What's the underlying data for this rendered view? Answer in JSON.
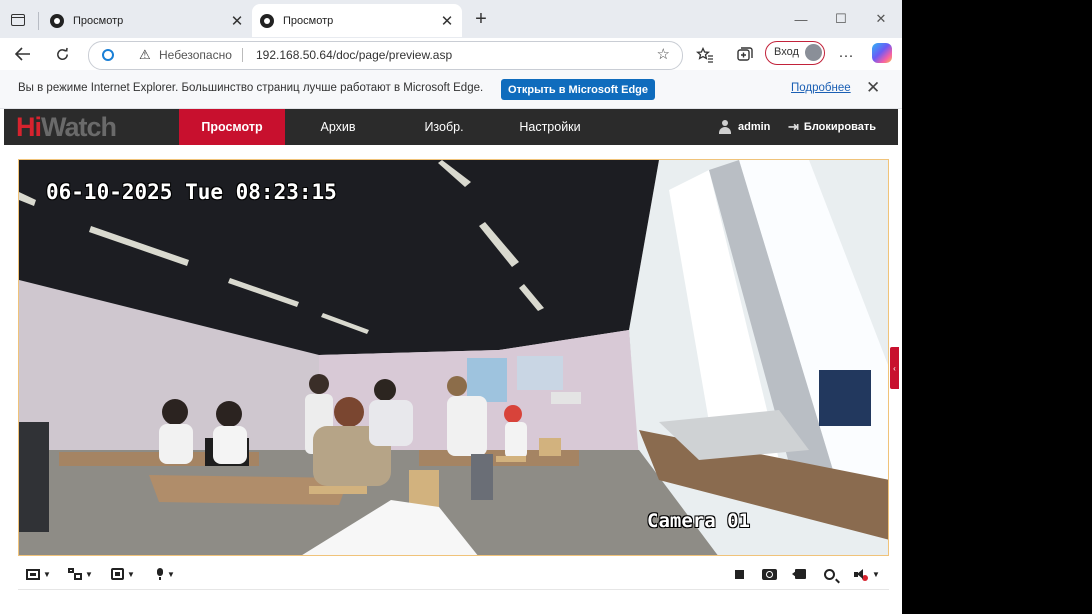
{
  "browser": {
    "tabs": [
      {
        "title": "Просмотр"
      },
      {
        "title": "Просмотр"
      }
    ],
    "security_text": "Небезопасно",
    "url": "192.168.50.64/doc/page/preview.asp",
    "signin_label": "Вход"
  },
  "ie_bar": {
    "message": "Вы в режиме Internet Explorer. Большинство страниц лучше работают в Microsoft Edge.",
    "open_button": "Открыть в Microsoft Edge",
    "more_link": "Подробнее"
  },
  "app": {
    "brand": {
      "hi": "Hi",
      "watch": "Watch"
    },
    "menu": [
      "Просмотр",
      "Архив",
      "Изобр.",
      "Настройки"
    ],
    "user": "admin",
    "logout": "Блокировать"
  },
  "video": {
    "timestamp": "06-10-2025 Tue 08:23:15",
    "camera_name": "Camera 01"
  },
  "colors": {
    "brand_red": "#c8102e",
    "nav_bg": "#2b2b2b",
    "edge_blue": "#0f6cbd",
    "viewport_border": "#f0c37a"
  }
}
